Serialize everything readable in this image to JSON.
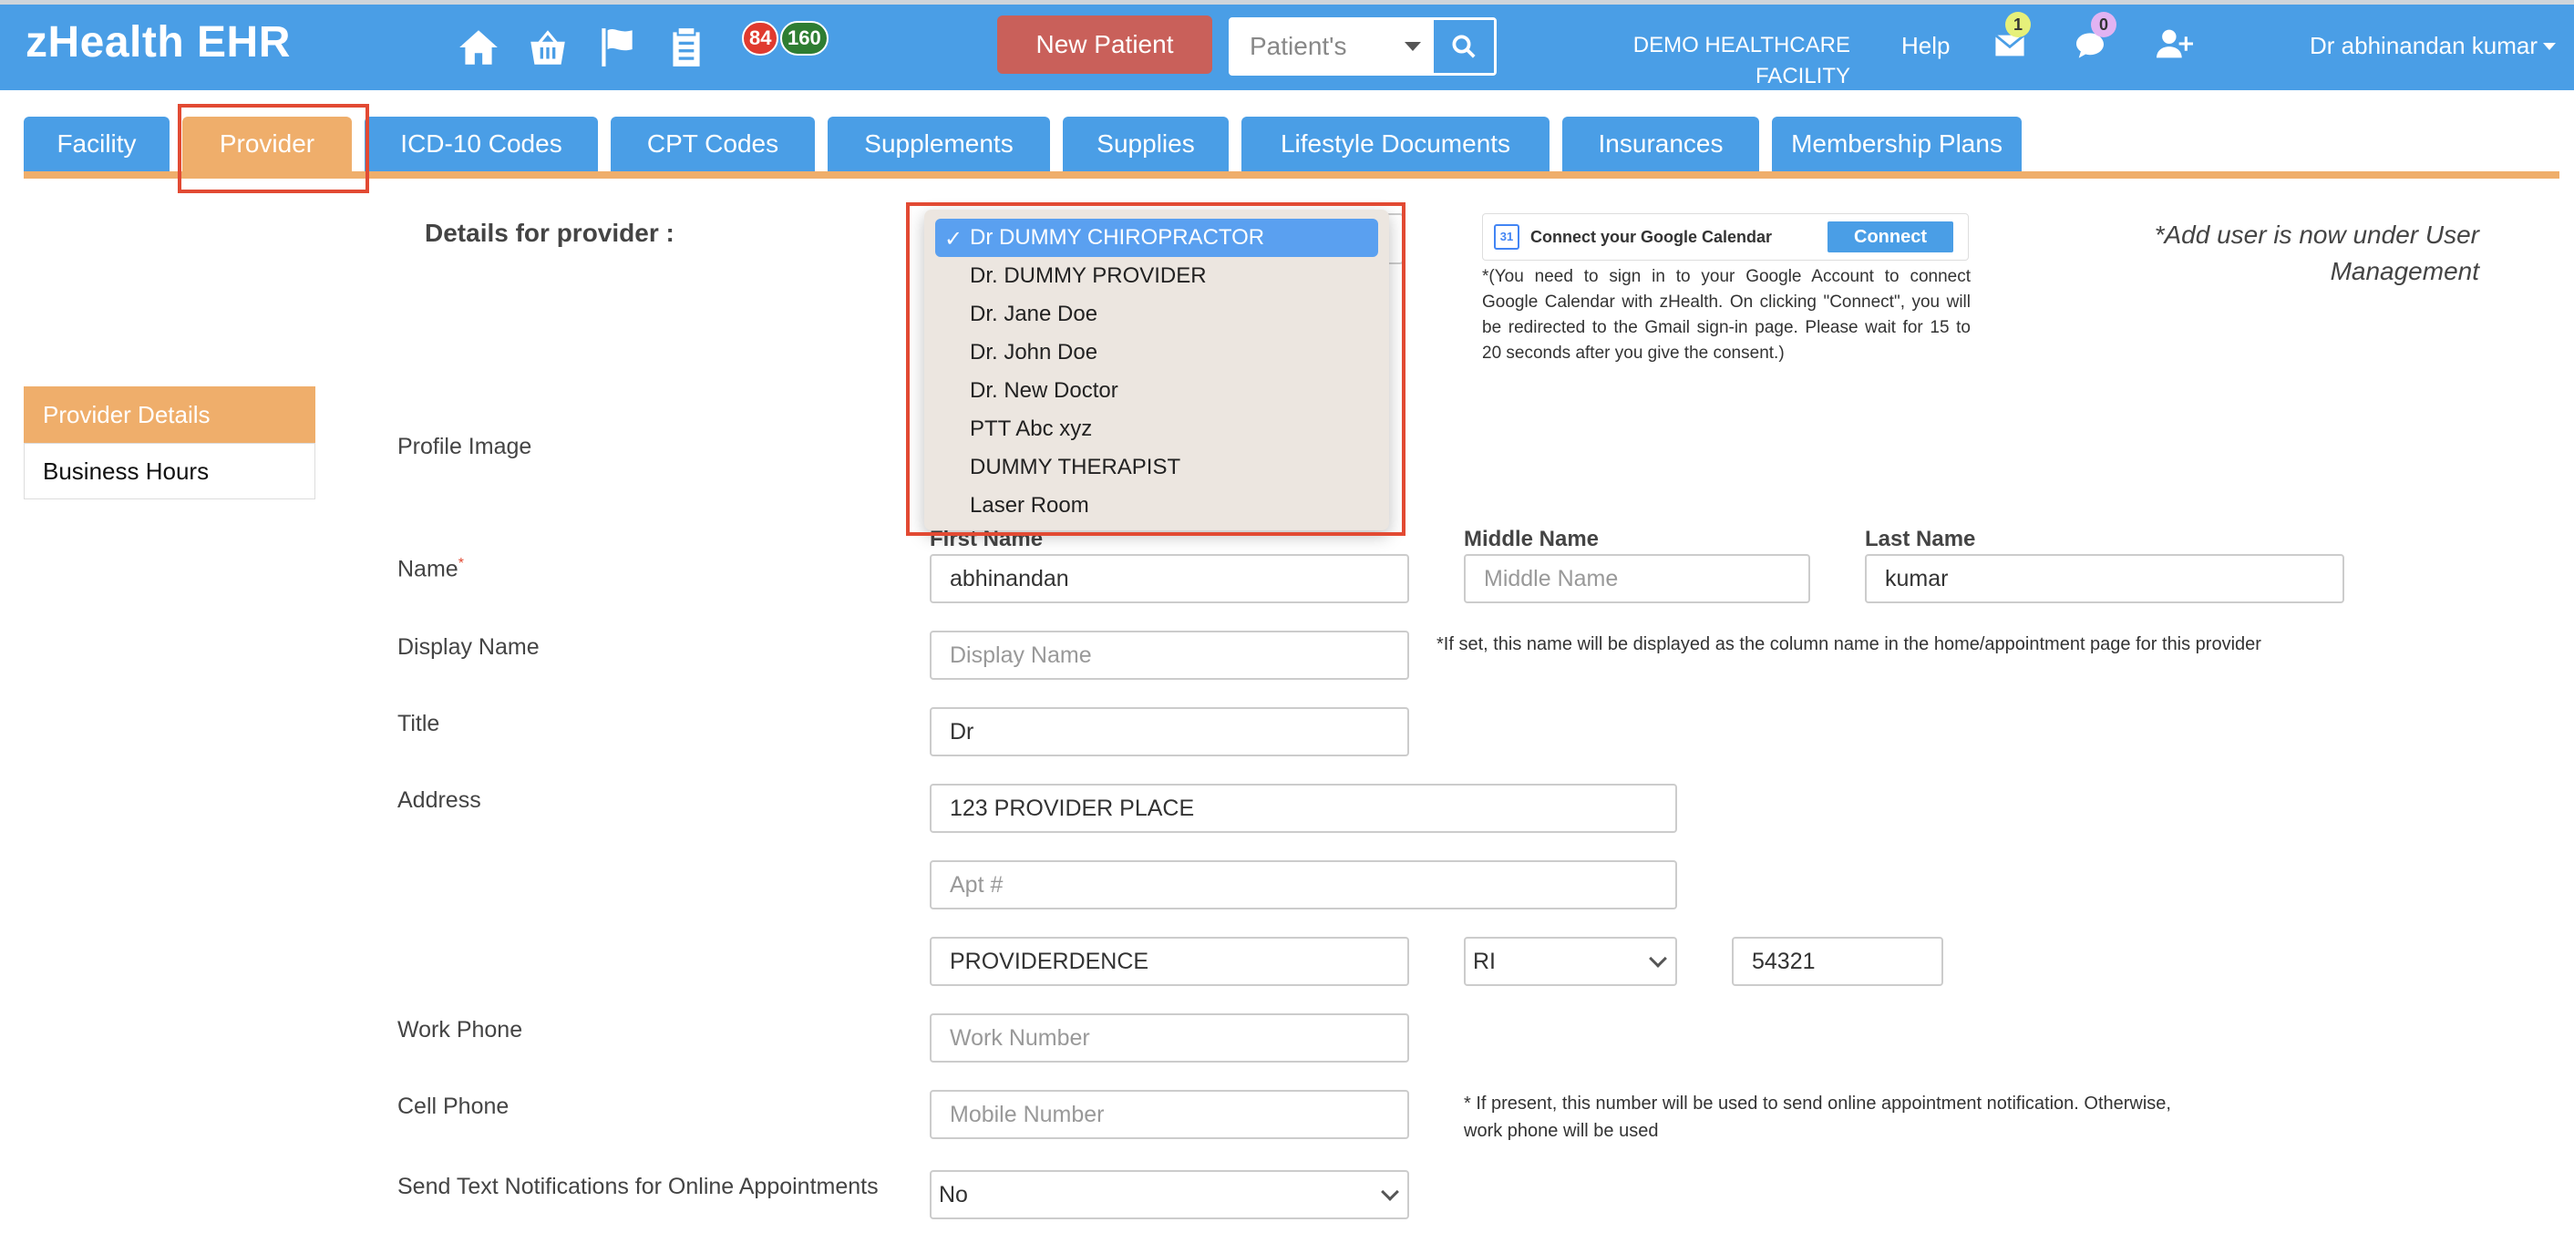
{
  "app": {
    "brand": "zHealth EHR"
  },
  "header": {
    "badges": {
      "red": "84",
      "green": "160"
    },
    "new_patient": "New Patient",
    "search": {
      "placeholder": "Patient's"
    },
    "facility": "DEMO HEALTHCARE FACILITY",
    "help": "Help",
    "messages_count": "1",
    "chat_count": "0",
    "user": "Dr abhinandan kumar"
  },
  "tabs": [
    {
      "label": "Facility",
      "active": false
    },
    {
      "label": "Provider",
      "active": true
    },
    {
      "label": "ICD-10 Codes",
      "active": false
    },
    {
      "label": "CPT Codes",
      "active": false
    },
    {
      "label": "Supplements",
      "active": false
    },
    {
      "label": "Supplies",
      "active": false
    },
    {
      "label": "Lifestyle Documents",
      "active": false
    },
    {
      "label": "Insurances",
      "active": false
    },
    {
      "label": "Membership Plans",
      "active": false
    }
  ],
  "details": {
    "label": "Details for provider :",
    "provider_options": [
      "Dr DUMMY CHIROPRACTOR",
      "Dr. DUMMY PROVIDER",
      "Dr. Jane Doe",
      "Dr. John Doe",
      "Dr. New Doctor",
      "PTT Abc xyz",
      "DUMMY THERAPIST",
      "Laser Room"
    ],
    "selected_index": 0
  },
  "calendar": {
    "title": "Connect your Google Calendar",
    "icon_text": "31",
    "connect": "Connect",
    "note": "*(You need to sign in to your Google Account to connect Google Calendar with zHealth. On clicking \"Connect\", you will be redirected to the Gmail sign-in page. Please wait for 15 to 20 seconds after you give the consent.)"
  },
  "add_user_note": "*Add user is now under User Management",
  "sidebar": [
    {
      "label": "Provider Details",
      "active": true
    },
    {
      "label": "Business Hours",
      "active": false
    }
  ],
  "form": {
    "profile_image": "Profile Image",
    "name_label": "Name",
    "required_mark": "*",
    "first_name": {
      "label": "First Name",
      "value": "abhinandan"
    },
    "middle_name": {
      "label": "Middle Name",
      "placeholder": "Middle Name"
    },
    "last_name": {
      "label": "Last Name",
      "value": "kumar"
    },
    "display_name": {
      "label": "Display Name",
      "placeholder": "Display Name",
      "hint": "*If set, this name will be displayed as the column name in the home/appointment page for this provider"
    },
    "title": {
      "label": "Title",
      "value": "Dr"
    },
    "address": {
      "label": "Address",
      "line1": "123 PROVIDER PLACE",
      "apt_placeholder": "Apt #",
      "city": "PROVIDERDENCE",
      "state": "RI",
      "zip": "54321"
    },
    "work_phone": {
      "label": "Work Phone",
      "placeholder": "Work Number"
    },
    "cell_phone": {
      "label": "Cell Phone",
      "placeholder": "Mobile Number",
      "hint": "* If present, this number will be used to send online appointment notification. Otherwise, work phone will be used"
    },
    "text_notifications": {
      "label": "Send Text Notifications for Online Appointments",
      "value": "No"
    }
  }
}
